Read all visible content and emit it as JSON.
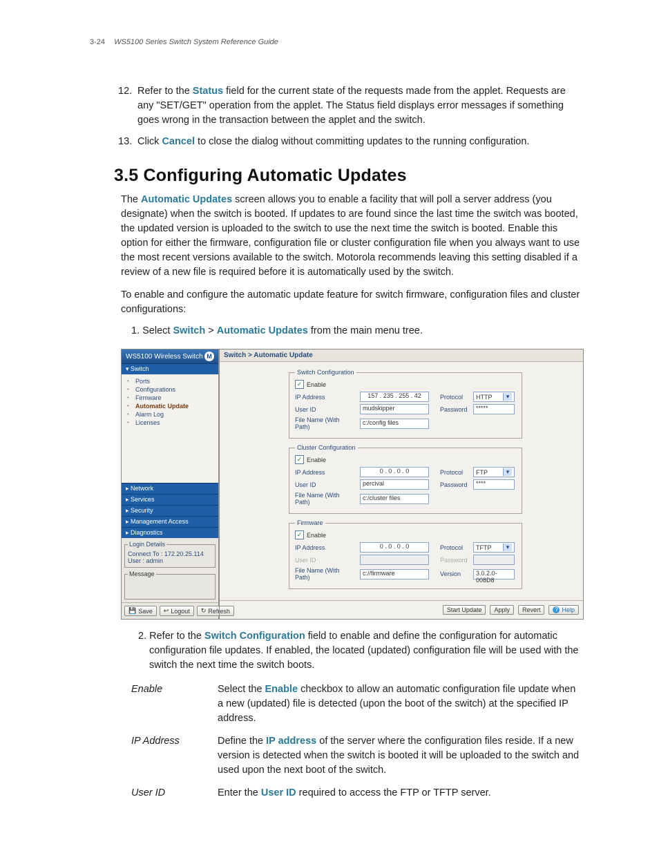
{
  "header": {
    "page_num": "3-24",
    "title": "WS5100 Series Switch System Reference Guide"
  },
  "item12": {
    "num": "12.",
    "lead": "Refer to the ",
    "bold": "Status",
    "rest": " field for the current state of the requests made from the applet. Requests are any \"SET/GET\" operation from the applet. The Status field displays error messages if something goes wrong in the transaction between the applet and the switch."
  },
  "item13": {
    "num": "13.",
    "lead": "Click ",
    "bold": "Cancel",
    "rest": " to close the dialog without committing updates to the running configuration."
  },
  "section_title": "3.5 Configuring Automatic Updates",
  "para1": {
    "pre": "The ",
    "bold": "Automatic Updates",
    "post": " screen allows you to enable a facility that will poll a server address (you designate) when the switch is booted. If updates to are found since the last time the switch was booted, the updated version is uploaded to the switch to use the next time the switch is booted. Enable this option for either the firmware, configuration file or cluster configuration file when you always want to use the most recent versions available to the switch. Motorola recommends leaving this setting disabled if a review of a new file is required before it is automatically used by the switch."
  },
  "para2": "To enable and configure the automatic update feature for switch firmware, configuration files and cluster configurations:",
  "step1": {
    "num": "1. ",
    "pre": "Select ",
    "b1": "Switch",
    "gt": " > ",
    "b2": "Automatic Updates",
    "post": " from the main menu tree."
  },
  "app": {
    "sidebar_title": "WS5100 Wireless Switch",
    "accordion": {
      "switch": "▾ Switch",
      "network": "▸ Network",
      "services": "▸ Services",
      "security": "▸ Security",
      "mgmt": "▸ Management Access",
      "diag": "▸ Diagnostics"
    },
    "tree": {
      "ports": "Ports",
      "config": "Configurations",
      "fw": "Firmware",
      "auto": "Automatic Update",
      "alarm": "Alarm Log",
      "lic": "Licenses"
    },
    "login": {
      "legend": "Login Details",
      "connect_lbl": "Connect To :",
      "connect": "172.20.25.114",
      "user_lbl": "User :",
      "user": "admin"
    },
    "msg_legend": "Message",
    "sb_buttons": {
      "save": "Save",
      "logout": "Logout",
      "refresh": "Refresh"
    },
    "crumb": "Switch > Automatic Update",
    "groups": {
      "switch_cfg": {
        "legend": "Switch Configuration",
        "enable": "Enable",
        "ip_lbl": "IP Address",
        "ip": "157 . 235 . 255 .  42",
        "proto_lbl": "Protocol",
        "proto": "HTTP",
        "uid_lbl": "User ID",
        "uid": "mudskipper",
        "pwd_lbl": "Password",
        "pwd": "*****",
        "file_lbl": "File Name (With Path)",
        "file": "c:/config files"
      },
      "cluster_cfg": {
        "legend": "Cluster Configuration",
        "enable": "Enable",
        "ip_lbl": "IP Address",
        "ip": "0  .  0  .  0  .  0",
        "proto_lbl": "Protocol",
        "proto": "FTP",
        "uid_lbl": "User ID",
        "uid": "percival",
        "pwd_lbl": "Password",
        "pwd": "****",
        "file_lbl": "File Name (With Path)",
        "file": "c:/cluster files"
      },
      "firmware": {
        "legend": "Firmware",
        "enable": "Enable",
        "ip_lbl": "IP Address",
        "ip": "0  .  0  .  0  .  0",
        "proto_lbl": "Protocol",
        "proto": "TFTP",
        "uid_lbl": "User ID",
        "uid": "",
        "pwd_lbl": "Password",
        "pwd": "",
        "file_lbl": "File Name (With Path)",
        "file": "c://firmware",
        "ver_lbl": "Version",
        "ver": "3.0.2.0-008D8"
      }
    },
    "main_buttons": {
      "start": "Start Update",
      "apply": "Apply",
      "revert": "Revert",
      "help": "Help"
    }
  },
  "step2": {
    "num": "2. ",
    "pre": "Refer to the ",
    "bold": "Switch Configuration",
    "post": " field to enable and define the configuration for automatic configuration file updates. If enabled, the located (updated) configuration file will be used with the switch the next time the switch boots."
  },
  "defs": {
    "enable": {
      "term": "Enable",
      "pre": "Select the ",
      "bold": "Enable",
      "post": " checkbox to allow an automatic configuration file update when a new (updated) file is detected (upon the boot of the switch) at the specified IP address."
    },
    "ip": {
      "term": "IP Address",
      "pre": "Define the ",
      "bold": "IP address",
      "post": " of the server where the configuration files reside. If a new version is detected when the switch is booted it will be uploaded to the switch and used upon the next boot of the switch."
    },
    "uid": {
      "term": "User ID",
      "pre": "Enter the ",
      "bold": "User ID",
      "post": " required to access the FTP or TFTP server."
    }
  }
}
